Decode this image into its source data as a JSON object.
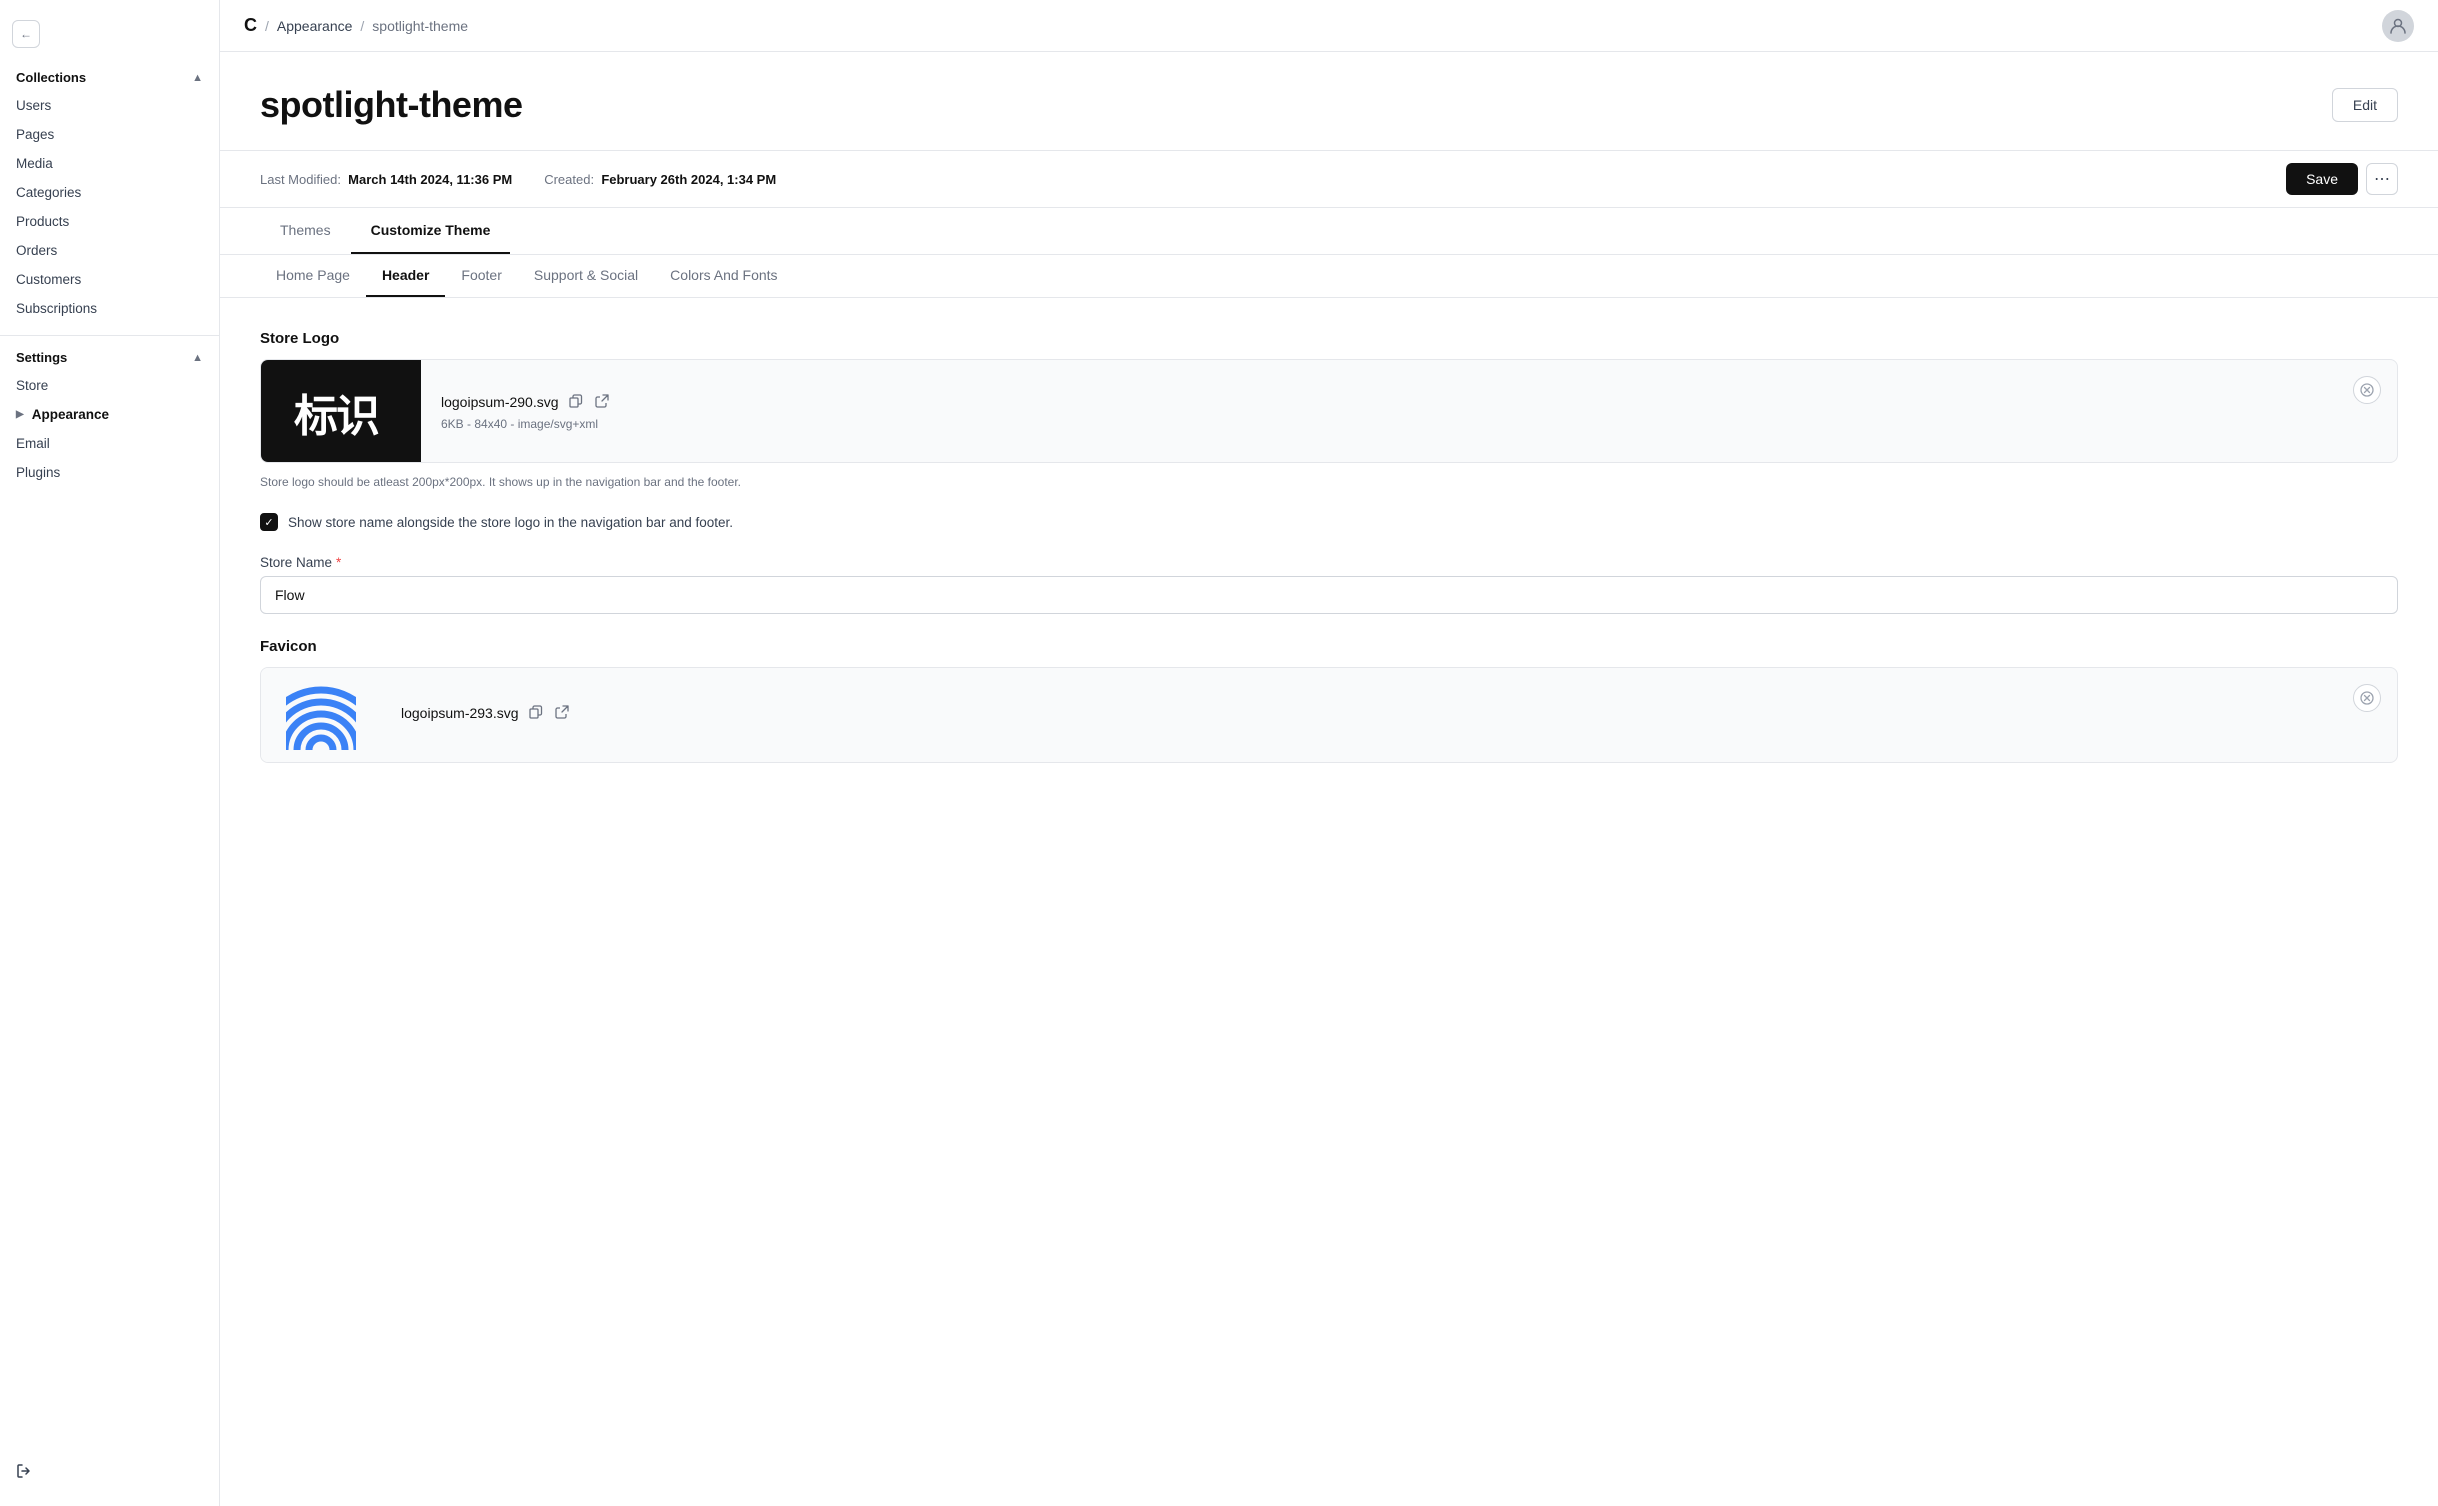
{
  "sidebar": {
    "toggle_label": "←",
    "sections": [
      {
        "title": "Collections",
        "expanded": true,
        "items": [
          {
            "label": "Users",
            "id": "users",
            "active": false
          },
          {
            "label": "Pages",
            "id": "pages",
            "active": false
          },
          {
            "label": "Media",
            "id": "media",
            "active": false
          },
          {
            "label": "Categories",
            "id": "categories",
            "active": false
          },
          {
            "label": "Products",
            "id": "products",
            "active": false
          },
          {
            "label": "Orders",
            "id": "orders",
            "active": false
          },
          {
            "label": "Customers",
            "id": "customers",
            "active": false
          },
          {
            "label": "Subscriptions",
            "id": "subscriptions",
            "active": false
          }
        ]
      },
      {
        "title": "Settings",
        "expanded": true,
        "items": [
          {
            "label": "Store",
            "id": "store",
            "active": false
          },
          {
            "label": "Appearance",
            "id": "appearance",
            "active": true,
            "expandable": true
          },
          {
            "label": "Email",
            "id": "email",
            "active": false
          },
          {
            "label": "Plugins",
            "id": "plugins",
            "active": false
          }
        ]
      }
    ],
    "logout_label": "Logout"
  },
  "topbar": {
    "logo": "C",
    "sep": "/",
    "breadcrumb_appearance": "Appearance",
    "breadcrumb_sep": "/",
    "breadcrumb_current": "spotlight-theme"
  },
  "page": {
    "title": "spotlight-theme",
    "edit_button": "Edit"
  },
  "meta": {
    "last_modified_label": "Last Modified:",
    "last_modified_value": "March 14th 2024, 11:36 PM",
    "created_label": "Created:",
    "created_value": "February 26th 2024, 1:34 PM",
    "save_button": "Save"
  },
  "tabs": [
    {
      "label": "Themes",
      "id": "themes",
      "active": false
    },
    {
      "label": "Customize Theme",
      "id": "customize",
      "active": true
    }
  ],
  "subtabs": [
    {
      "label": "Home Page",
      "id": "homepage",
      "active": false
    },
    {
      "label": "Header",
      "id": "header",
      "active": true
    },
    {
      "label": "Footer",
      "id": "footer",
      "active": false
    },
    {
      "label": "Support & Social",
      "id": "support",
      "active": false
    },
    {
      "label": "Colors And Fonts",
      "id": "colors",
      "active": false
    }
  ],
  "form": {
    "store_logo_label": "Store Logo",
    "logo_filename": "logoipsum-290.svg",
    "logo_meta": "6KB - 84x40 - image/svg+xml",
    "logo_hint": "Store logo should be atleast 200px*200px. It shows up in the navigation bar and the footer.",
    "checkbox_label": "Show store name alongside the store logo in the navigation bar and footer.",
    "checkbox_checked": true,
    "store_name_label": "Store Name",
    "store_name_required": "*",
    "store_name_value": "Flow",
    "favicon_label": "Favicon",
    "favicon_filename": "logoipsum-293.svg",
    "favicon_meta": ""
  }
}
